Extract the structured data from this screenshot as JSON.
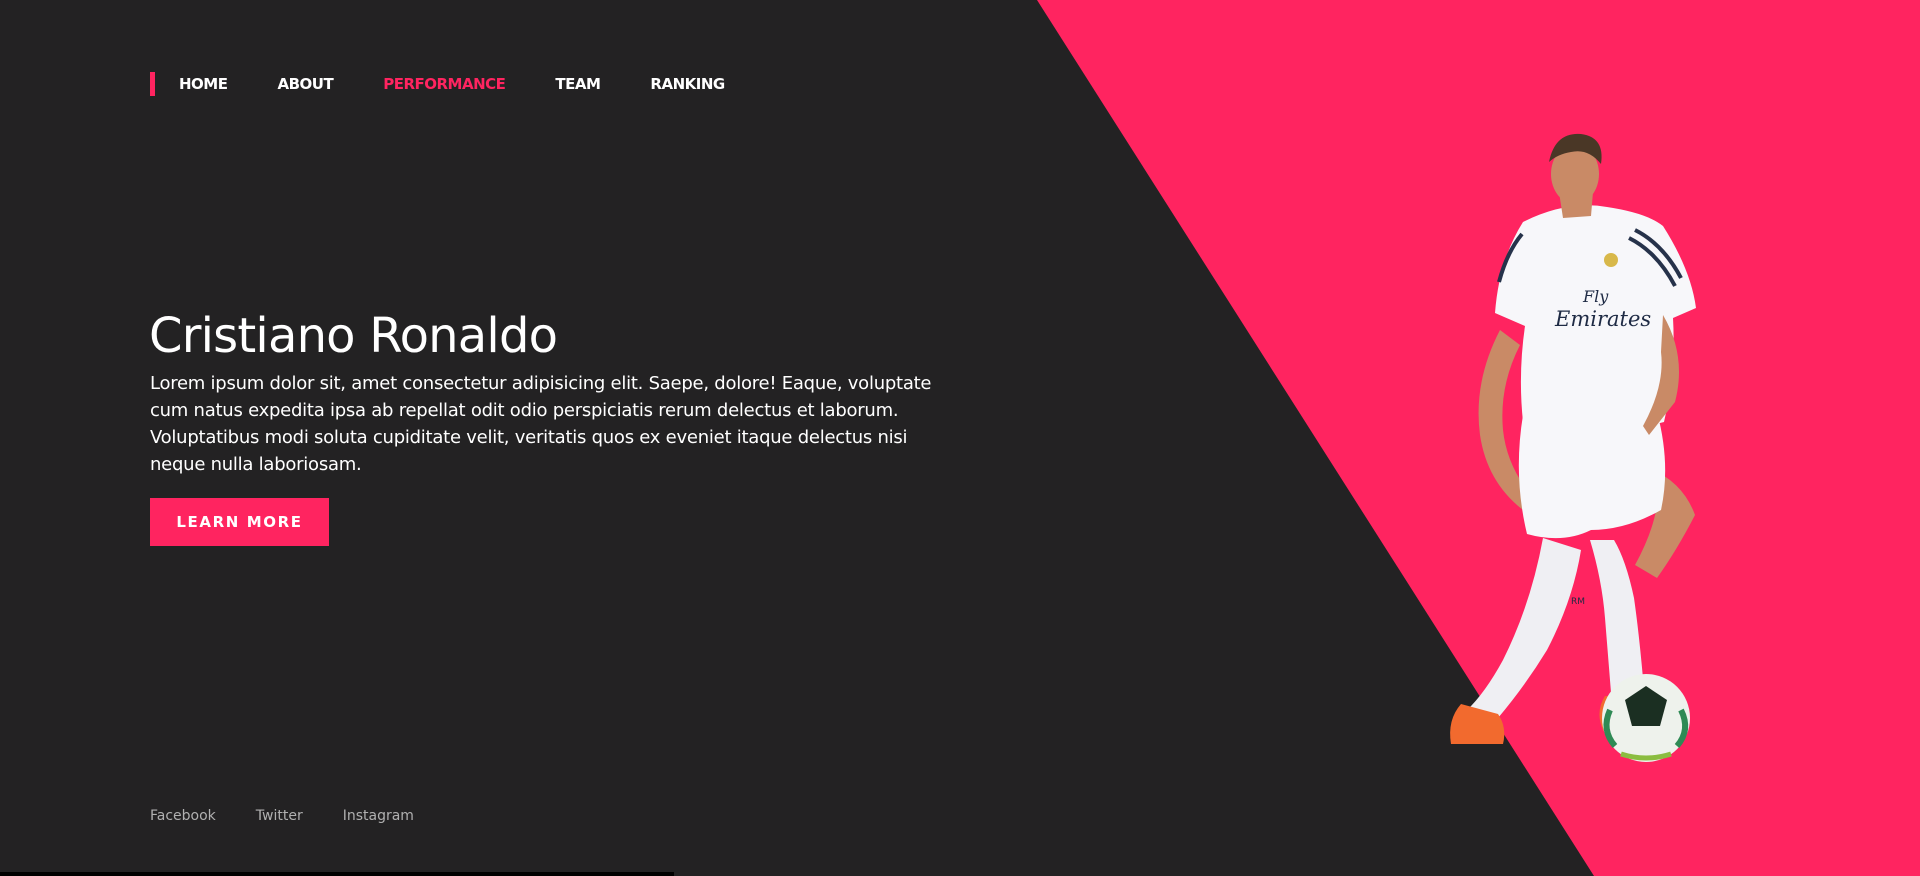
{
  "nav": {
    "items": [
      {
        "label": "HOME",
        "active": false
      },
      {
        "label": "ABOUT",
        "active": false
      },
      {
        "label": "PERFORMANCE",
        "active": true
      },
      {
        "label": "TEAM",
        "active": false
      },
      {
        "label": "RANKING",
        "active": false
      }
    ]
  },
  "hero": {
    "title": "Cristiano Ronaldo",
    "description": "Lorem ipsum dolor sit, amet consectetur adipisicing elit. Saepe, dolore! Eaque, voluptate cum natus expedita ipsa ab repellat odit odio perspiciatis rerum delectus et laborum. Voluptatibus modi soluta cupiditate velit, veritatis quos ex eveniet itaque delectus nisi neque nulla laboriosam.",
    "cta_label": "LEARN MORE"
  },
  "social": [
    "Facebook",
    "Twitter",
    "Instagram"
  ],
  "jersey": {
    "sponsor_line1": "Fly",
    "sponsor_line2": "Emirates",
    "sock_text": "RM"
  },
  "colors": {
    "accent": "#ff2460",
    "background": "#232223",
    "text": "#ffffff",
    "muted_text": "#b0b0b0"
  },
  "icons": {
    "nav_marker": "accent-bar",
    "player_image": "football-player-illustration",
    "ball": "soccer-ball"
  }
}
